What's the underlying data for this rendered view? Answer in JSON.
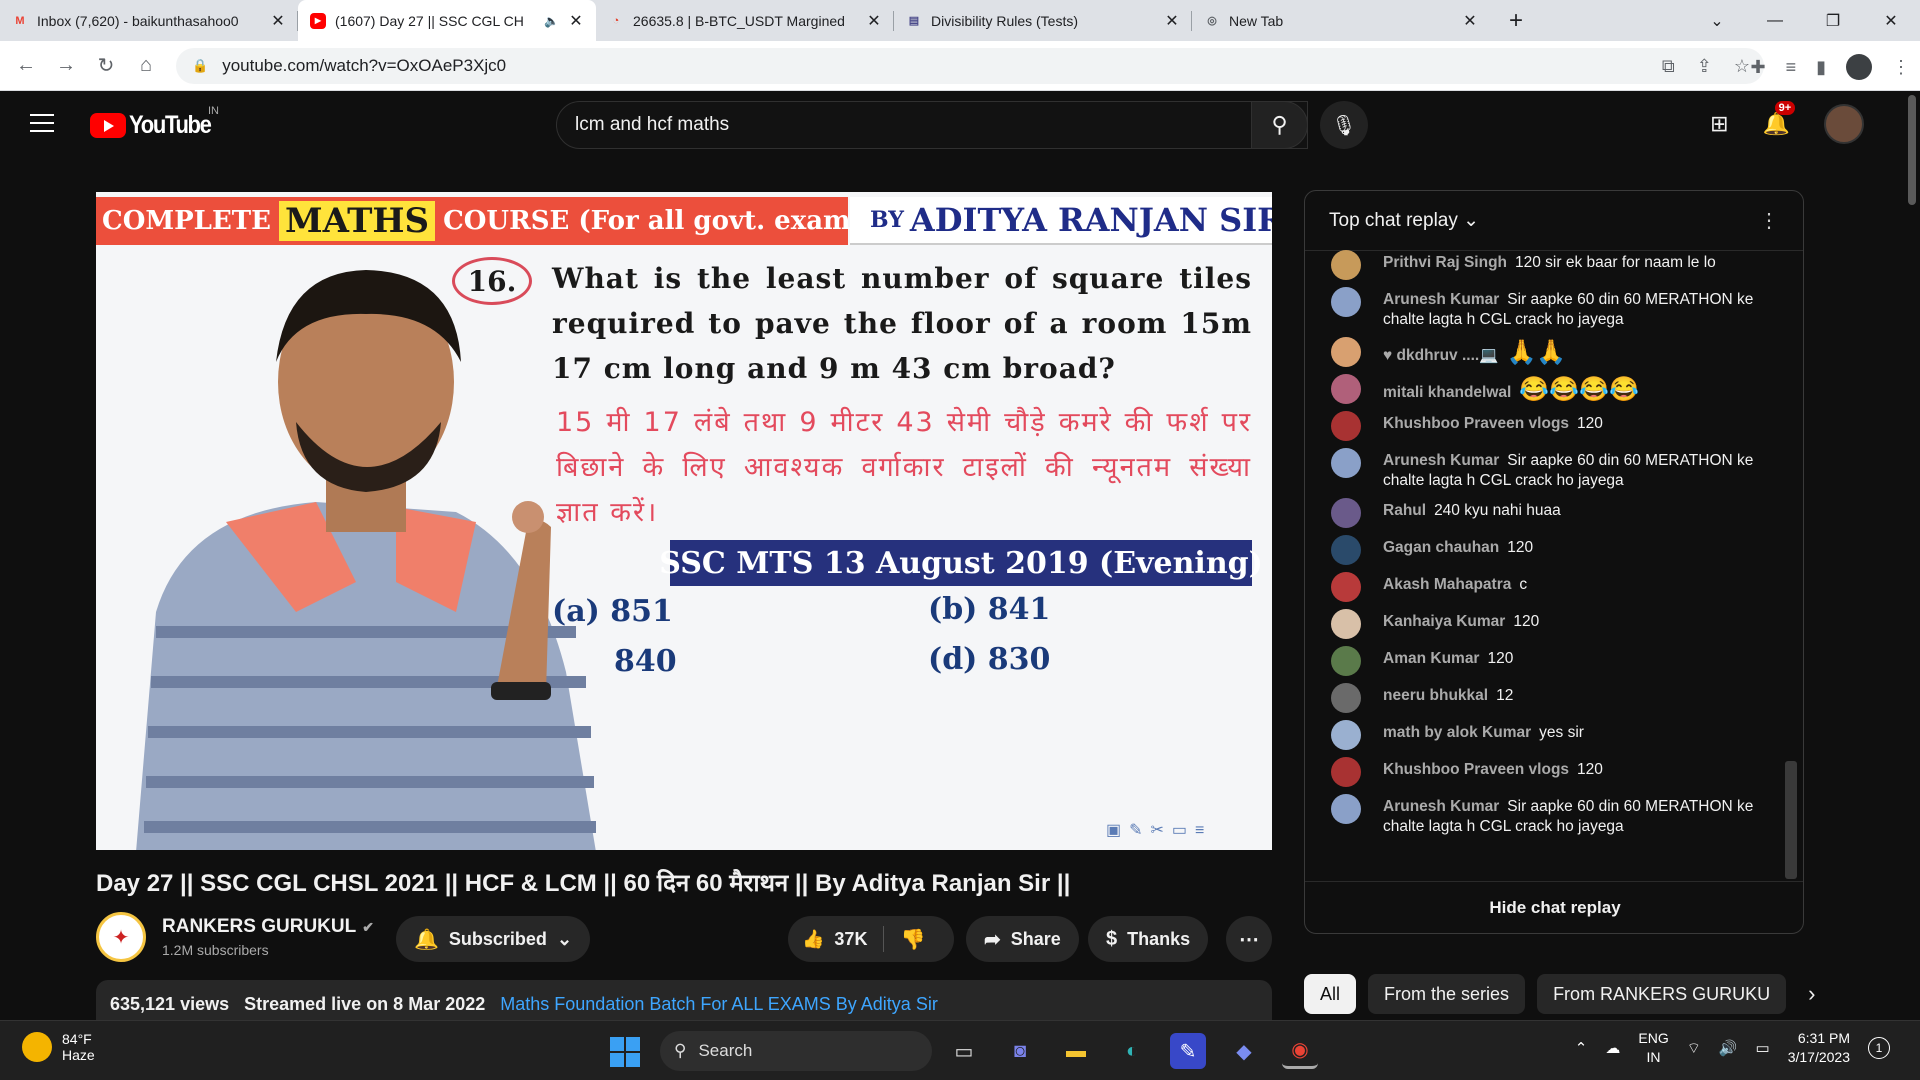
{
  "browser": {
    "tabs": [
      {
        "title": "Inbox (7,620) - baikunthasahoo0",
        "favicon": "gmail-icon",
        "color": "#ea4335",
        "active": false
      },
      {
        "title": "(1607) Day 27 || SSC CGL CH",
        "favicon": "youtube-icon",
        "color": "#ff0000",
        "active": true
      },
      {
        "title": "26635.8 | B-BTC_USDT Margined",
        "favicon": "exchange-icon",
        "color": "#e4402b",
        "active": false
      },
      {
        "title": "Divisibility Rules (Tests)",
        "favicon": "test-icon",
        "color": "#4a4a8a",
        "active": false
      },
      {
        "title": "New Tab",
        "favicon": "chrome-icon",
        "color": "#5f6368",
        "active": false
      }
    ],
    "url": "youtube.com/watch?v=OxOAeP3Xjc0"
  },
  "youtube": {
    "logo_text": "YouTube",
    "country": "IN",
    "search_value": "lcm and hcf maths",
    "notif_count": "9+"
  },
  "video": {
    "banner_left_1": "COMPLETE",
    "banner_maths": "MATHS",
    "banner_left_2": "COURSE (For all govt. exams )",
    "banner_by": "BY",
    "banner_right": "ADITYA RANJAN SIR",
    "qnum": "16.",
    "question_en": "What is the least number of square tiles required to pave the floor of a room 15m 17 cm long and 9 m 43 cm broad?",
    "question_hi": "15 मी 17 लंबे तथा 9 मीटर 43 सेमी चौड़े कमरे की फर्श पर बिछाने के लिए आवश्यक वर्गाकार टाइलों की न्यूनतम संख्या ज्ञात करें।",
    "exam": "SSC MTS 13 August 2019 (Evening)",
    "opt_a": "(a) 851",
    "opt_b": "(b) 841",
    "opt_c": "840",
    "opt_d": "(d) 830",
    "title": "Day 27 || SSC CGL CHSL 2021 || HCF & LCM || 60 दिन 60 मैराथन || By Aditya Ranjan Sir ||",
    "channel": "RANKERS GURUKUL",
    "subscribers": "1.2M subscribers",
    "subscribe_label": "Subscribed",
    "likes": "37K",
    "share_label": "Share",
    "thanks_label": "Thanks",
    "views": "635,121 views",
    "streamed": "Streamed live on 8 Mar 2022",
    "desc_link": "Maths Foundation Batch For ALL EXAMS By Aditya Sir"
  },
  "chat": {
    "header": "Top chat replay",
    "footer": "Hide chat replay",
    "messages": [
      {
        "author": "Prithvi Raj Singh",
        "text": "120 sir ek baar for naam le lo",
        "color": "#c79a5a"
      },
      {
        "author": "Arunesh Kumar",
        "text": "Sir aapke 60 din 60 MERATHON ke chalte lagta h CGL crack ho jayega",
        "color": "#8aa0c8"
      },
      {
        "author": "♥ dkdhruv ....💻",
        "text": "🙏🙏",
        "color": "#d8a070"
      },
      {
        "author": "mitali khandelwal",
        "text": "😂😂😂😂",
        "color": "#b0607a"
      },
      {
        "author": "Khushboo Praveen vlogs",
        "text": "120",
        "color": "#a83232"
      },
      {
        "author": "Arunesh Kumar",
        "text": "Sir aapke 60 din 60 MERATHON ke chalte lagta h CGL crack ho jayega",
        "color": "#8aa0c8"
      },
      {
        "author": "Rahul",
        "text": "240 kyu nahi huaa",
        "color": "#6a5a8a"
      },
      {
        "author": "Gagan chauhan",
        "text": "120",
        "color": "#2a4a6a"
      },
      {
        "author": "Akash Mahapatra",
        "text": "c",
        "color": "#b83a3a"
      },
      {
        "author": "Kanhaiya Kumar",
        "text": "120",
        "color": "#d8c0a8"
      },
      {
        "author": "Aman Kumar",
        "text": "120",
        "color": "#5a7a4a"
      },
      {
        "author": "neeru bhukkal",
        "text": "12",
        "color": "#6a6a6a"
      },
      {
        "author": "math by alok Kumar",
        "text": "yes sir",
        "color": "#9ab0d0"
      },
      {
        "author": "Khushboo Praveen vlogs",
        "text": "120",
        "color": "#a83232"
      },
      {
        "author": "Arunesh Kumar",
        "text": "Sir aapke 60 din 60 MERATHON ke chalte lagta h CGL crack ho jayega",
        "color": "#8aa0c8"
      }
    ]
  },
  "chips": [
    "All",
    "From the series",
    "From RANKERS GURUKU"
  ],
  "taskbar": {
    "temp": "84°F",
    "weather": "Haze",
    "search": "Search",
    "lang1": "ENG",
    "lang2": "IN",
    "time": "6:31 PM",
    "date": "3/17/2023",
    "notif": "1"
  }
}
